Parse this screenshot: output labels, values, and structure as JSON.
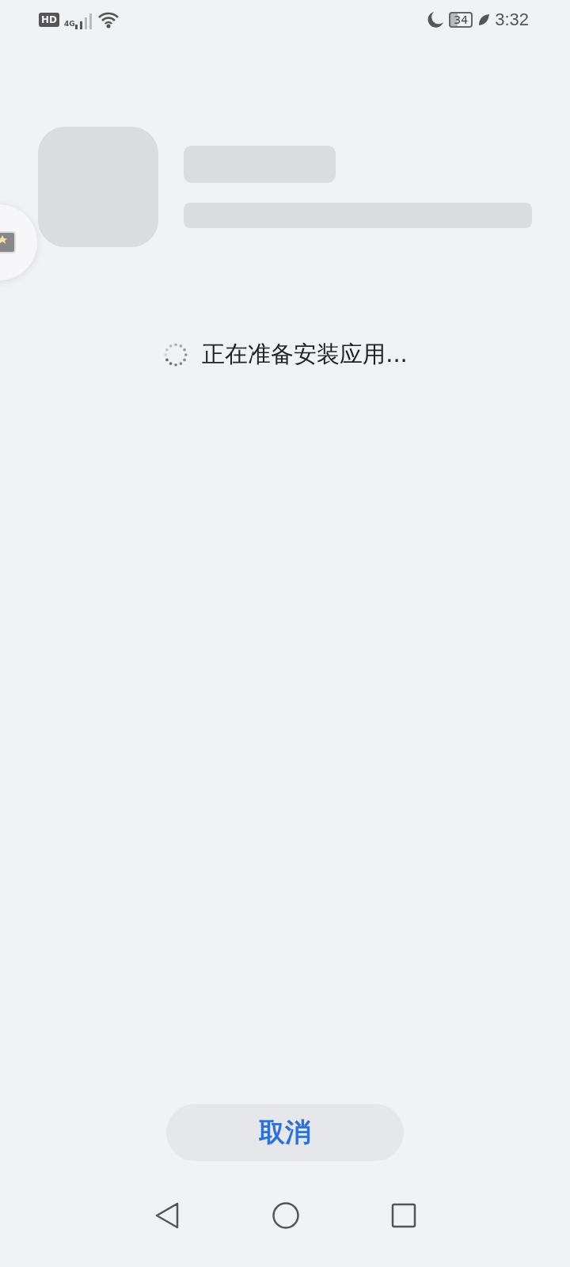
{
  "status_bar": {
    "hd": "HD",
    "network": "4G",
    "battery": "34",
    "time": "3:32"
  },
  "loading": {
    "text": "正在准备安装应用..."
  },
  "cancel_button": {
    "label": "取消"
  }
}
